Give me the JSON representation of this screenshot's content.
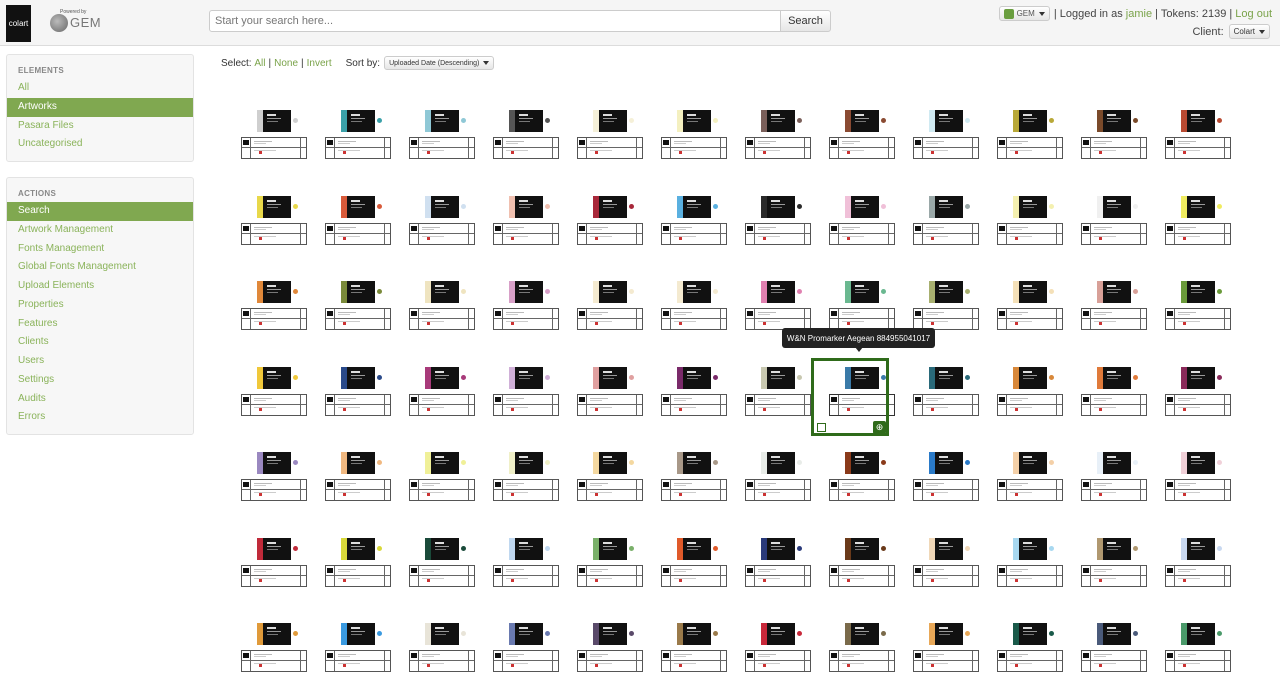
{
  "header": {
    "logo_text": "colart",
    "powered_by": "Powered by",
    "gem_logo": "GEM",
    "search_placeholder": "Start your search here...",
    "search_button": "Search",
    "gem_dropdown": "GEM",
    "logged_in_prefix": "| Logged in as",
    "username": "jamie",
    "tokens_text": "| Tokens: 2139 |",
    "logout": "Log out",
    "client_label": "Client:",
    "client_value": "Colart"
  },
  "sidebar": {
    "elements_header": "ELEMENTS",
    "elements": [
      {
        "label": "All",
        "active": false
      },
      {
        "label": "Artworks",
        "active": true
      },
      {
        "label": "Pasara Files",
        "active": false
      },
      {
        "label": "Uncategorised",
        "active": false
      }
    ],
    "actions_header": "ACTIONS",
    "actions": [
      {
        "label": "Search",
        "active": true
      },
      {
        "label": "Artwork Management",
        "active": false
      },
      {
        "label": "Fonts Management",
        "active": false
      },
      {
        "label": "Global Fonts Management",
        "active": false
      },
      {
        "label": "Upload Elements",
        "active": false
      },
      {
        "label": "Properties",
        "active": false
      },
      {
        "label": "Features",
        "active": false
      },
      {
        "label": "Clients",
        "active": false
      },
      {
        "label": "Users",
        "active": false
      },
      {
        "label": "Settings",
        "active": false
      },
      {
        "label": "Audits",
        "active": false
      },
      {
        "label": "Errors",
        "active": false
      }
    ]
  },
  "toolbar": {
    "select_label": "Select:",
    "all": "All",
    "none": "None",
    "invert": "Invert",
    "sort_label": "Sort by:",
    "sort_value": "Uploaded Date (Descending)"
  },
  "tooltip": "W&N Promarker Aegean 884955041017",
  "colors": {
    "accent": "#80a850",
    "link": "#8ab35a",
    "selection": "#2f6b1a"
  },
  "grid": {
    "selected": [
      3,
      7
    ],
    "rows": [
      [
        "#cfcfcf",
        "#3aa0a8",
        "#8fc8d6",
        "#555555",
        "#f5f0d8",
        "#f4f0c0",
        "#7a5f5a",
        "#8a4a32",
        "#d0eaf2",
        "#b8a838",
        "#7a4a2a",
        "#b84a32"
      ],
      [
        "#e8d84a",
        "#d85a3a",
        "#d0e0f0",
        "#f0c0b0",
        "#a8283a",
        "#5ab0e0",
        "#2a2a2a",
        "#f0c0d8",
        "#9aa8a8",
        "#f4f0b0",
        "#f0f0f0",
        "#f0ec60"
      ],
      [
        "#e0883a",
        "#7a8a3a",
        "#efe4c0",
        "#d8a0c8",
        "#f4ead0",
        "#f4ead0",
        "#e080b0",
        "#6ab890",
        "#a8b070",
        "#f4e0b8",
        "#d8a098",
        "#6a9a3a"
      ],
      [
        "#f0c83a",
        "#2a4a8a",
        "#a83a7a",
        "#d0b0d8",
        "#e0a0a0",
        "#7a2a6a",
        "#c8c8b0",
        "#3a7aa8",
        "#2a6a7a",
        "#d8883a",
        "#e07a3a",
        "#8a2a5a"
      ],
      [
        "#9a88c0",
        "#f0b880",
        "#f0f098",
        "#f0f0c8",
        "#f4d8a0",
        "#a89888",
        "#e8ece8",
        "#8a3a1a",
        "#2a7ac8",
        "#f4d0a8",
        "#e8f0f8",
        "#f0d0d8"
      ],
      [
        "#c02a3a",
        "#d8d83a",
        "#1a4a3a",
        "#c0d8f0",
        "#7ab06a",
        "#e05a2a",
        "#2a3a7a",
        "#6a3a1a",
        "#f0d8b8",
        "#a8d8f0",
        "#b09870",
        "#c8d8f0"
      ],
      [
        "#e09a3a",
        "#3a9ae0",
        "#e8e4d8",
        "#6a7ab0",
        "#5a4a6a",
        "#9a7a4a",
        "#c8283a",
        "#7a6a4a",
        "#e8a858",
        "#1a5a4a",
        "#4a5a7a",
        "#4a9a6a"
      ]
    ]
  }
}
